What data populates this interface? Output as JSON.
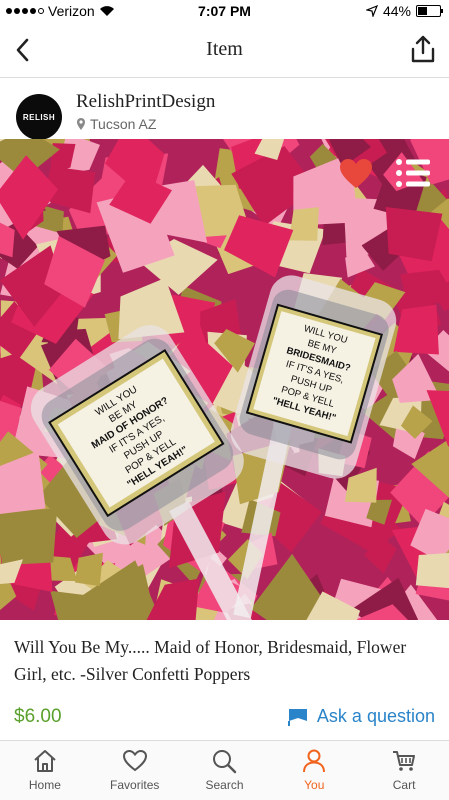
{
  "status_bar": {
    "carrier": "Verizon",
    "time": "7:07 PM",
    "battery": "44%",
    "battery_level": 0.44
  },
  "nav": {
    "title": "Item"
  },
  "shop": {
    "name": "RelishPrintDesign",
    "location": "Tucson AZ",
    "avatar_text": "RELISH"
  },
  "labels": {
    "left": [
      "WILL YOU",
      "BE MY",
      "MAID OF HONOR?",
      "IF IT'S A YES,",
      "PUSH UP",
      "POP & YELL",
      "\"HELL YEAH!\""
    ],
    "right": [
      "WILL YOU",
      "BE MY",
      "BRIDESMAID?",
      "IF IT'S A YES,",
      "PUSH UP",
      "POP & YELL",
      "\"HELL YEAH!\""
    ]
  },
  "item": {
    "title": "Will You Be My..... Maid of Honor, Bridesmaid, Flower Girl, etc. -Silver Confetti Poppers",
    "price": "$6.00",
    "ask_label": "Ask a question"
  },
  "tabs": [
    {
      "label": "Home",
      "icon": "home-icon",
      "active": false
    },
    {
      "label": "Favorites",
      "icon": "heart-icon",
      "active": false
    },
    {
      "label": "Search",
      "icon": "search-icon",
      "active": false
    },
    {
      "label": "You",
      "icon": "person-icon",
      "active": true
    },
    {
      "label": "Cart",
      "icon": "cart-icon",
      "active": false
    }
  ],
  "colors": {
    "accent_orange": "#f1641e",
    "price_green": "#5aa02c",
    "link_blue": "#2a84c9",
    "favorite_red": "#e8483b"
  }
}
